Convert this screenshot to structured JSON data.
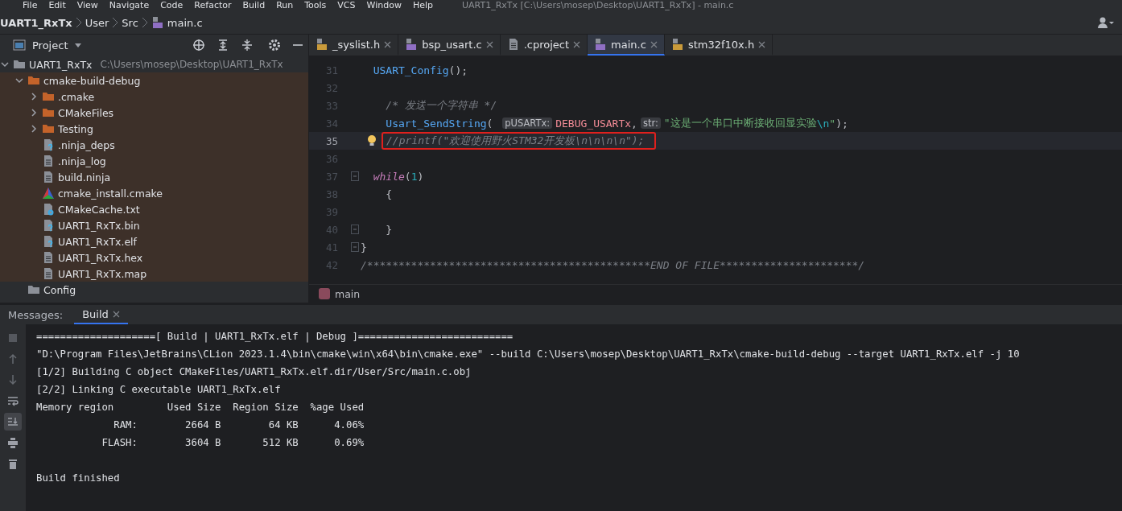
{
  "menu": [
    "File",
    "Edit",
    "View",
    "Navigate",
    "Code",
    "Refactor",
    "Build",
    "Run",
    "Tools",
    "VCS",
    "Window",
    "Help"
  ],
  "window": {
    "title": "UART1_RxTx [C:\\Users\\mosep\\Desktop\\UART1_RxTx] - main.c"
  },
  "breadcrumb": [
    "UART1_RxTx",
    "User",
    "Src",
    "main.c"
  ],
  "project_panel": {
    "title": "Project",
    "tree": [
      {
        "label": "UART1_RxTx",
        "hint": "C:\\Users\\mosep\\Desktop\\UART1_RxTx",
        "kind": "folder-plain",
        "expanded": true,
        "excluded": false,
        "children": [
          {
            "label": "cmake-build-debug",
            "kind": "folder",
            "expanded": true,
            "excluded": true,
            "children": [
              {
                "label": ".cmake",
                "kind": "folder",
                "expanded": false,
                "excluded": true
              },
              {
                "label": "CMakeFiles",
                "kind": "folder",
                "expanded": false,
                "excluded": true
              },
              {
                "label": "Testing",
                "kind": "folder",
                "expanded": false,
                "excluded": true
              },
              {
                "label": ".ninja_deps",
                "kind": "unknown",
                "excluded": true
              },
              {
                "label": ".ninja_log",
                "kind": "text",
                "excluded": true
              },
              {
                "label": "build.ninja",
                "kind": "text",
                "excluded": true
              },
              {
                "label": "cmake_install.cmake",
                "kind": "cmake",
                "excluded": true
              },
              {
                "label": "CMakeCache.txt",
                "kind": "settings",
                "excluded": true
              },
              {
                "label": "UART1_RxTx.bin",
                "kind": "unknown",
                "excluded": true
              },
              {
                "label": "UART1_RxTx.elf",
                "kind": "unknown",
                "excluded": true
              },
              {
                "label": "UART1_RxTx.hex",
                "kind": "text",
                "excluded": true
              },
              {
                "label": "UART1_RxTx.map",
                "kind": "text",
                "excluded": true
              }
            ]
          },
          {
            "label": "Config",
            "kind": "folder-plain",
            "excluded": false
          }
        ]
      }
    ]
  },
  "tabs": [
    {
      "label": "_syslist.h",
      "kind": "h",
      "selected": false
    },
    {
      "label": "bsp_usart.c",
      "kind": "c",
      "selected": false
    },
    {
      "label": ".cproject",
      "kind": "text",
      "selected": false
    },
    {
      "label": "main.c",
      "kind": "c",
      "selected": true
    },
    {
      "label": "stm32f10x.h",
      "kind": "h",
      "selected": false
    }
  ],
  "code": [
    {
      "number": "31",
      "current": false,
      "tokens": [
        {
          "text": "  USART_Config",
          "kind": "fn"
        },
        {
          "text": "();",
          "kind": "punct"
        }
      ]
    },
    {
      "number": "32",
      "current": false
    },
    {
      "number": "33",
      "current": false,
      "tokens": [
        {
          "text": "    /* 发送一个字符串 */",
          "kind": "comment"
        }
      ]
    },
    {
      "number": "34",
      "current": false,
      "tokens": [
        {
          "text": "    Usart_SendString",
          "kind": "fn"
        },
        {
          "text": "( ",
          "kind": "punct"
        },
        {
          "text": "pUSARTx:",
          "kind": "hint"
        },
        {
          "text": "DEBUG_USARTx",
          "kind": "macro"
        },
        {
          "text": ",",
          "kind": "punct"
        },
        {
          "text": "str:",
          "kind": "hint"
        },
        {
          "text": "\"这是一个串口中断接收回显实验",
          "kind": "string"
        },
        {
          "text": "\\n",
          "kind": "escape"
        },
        {
          "text": "\"",
          "kind": "string"
        },
        {
          "text": ");",
          "kind": "punct"
        }
      ]
    },
    {
      "number": "35",
      "current": true,
      "boxed": true,
      "bulb": true,
      "tokens": [
        {
          "text": "//printf(\"欢迎使用野火STM32开发板\\n\\n\\n\\n\");",
          "kind": "comment"
        }
      ]
    },
    {
      "number": "36",
      "current": false
    },
    {
      "number": "37",
      "current": false,
      "fold": true,
      "tokens": [
        {
          "text": "  while",
          "kind": "keyword"
        },
        {
          "text": "(",
          "kind": "punct"
        },
        {
          "text": "1",
          "kind": "number"
        },
        {
          "text": ")",
          "kind": "punct"
        }
      ]
    },
    {
      "number": "38",
      "current": false,
      "tokens": [
        {
          "text": "    {",
          "kind": "punct"
        }
      ]
    },
    {
      "number": "39",
      "current": false
    },
    {
      "number": "40",
      "current": false,
      "fold": true,
      "tokens": [
        {
          "text": "    }",
          "kind": "punct"
        }
      ]
    },
    {
      "number": "41",
      "current": false,
      "fold": true,
      "tokens": [
        {
          "text": "}",
          "kind": "punct"
        }
      ]
    },
    {
      "number": "42",
      "current": false,
      "tokens": [
        {
          "text": "/*********************************************END OF FILE**********************/",
          "kind": "comment"
        }
      ]
    }
  ],
  "editor_breadcrumb": "main",
  "bottom_panel": {
    "label": "Messages:",
    "tabs": [
      {
        "label": "Build",
        "selected": true
      }
    ],
    "tools": [
      {
        "kind": "stop",
        "selected": false
      },
      {
        "kind": "up",
        "selected": false
      },
      {
        "kind": "down",
        "selected": false
      },
      {
        "kind": "wrap",
        "selected": false
      },
      {
        "kind": "scroll-end",
        "selected": true
      },
      {
        "kind": "print",
        "selected": false
      },
      {
        "kind": "trash",
        "selected": false
      }
    ],
    "output": [
      {
        "text": "====================[ Build | UART1_RxTx.elf | Debug ]==========================",
        "kind": "line"
      },
      {
        "text": "\"D:\\Program Files\\JetBrains\\CLion 2023.1.4\\bin\\cmake\\win\\x64\\bin\\cmake.exe\" --build C:\\Users\\mosep\\Desktop\\UART1_RxTx\\cmake-build-debug --target UART1_RxTx.elf -j 10",
        "kind": "line"
      },
      {
        "text": "[1/2] Building C object CMakeFiles/UART1_RxTx.elf.dir/User/Src/main.c.obj",
        "kind": "line"
      },
      {
        "text": "[2/2] Linking C executable UART1_RxTx.elf",
        "kind": "line"
      },
      {
        "text": "Memory region         Used Size  Region Size  %age Used",
        "kind": "line"
      },
      {
        "text": "             RAM:        2664 B        64 KB      4.06%",
        "kind": "line"
      },
      {
        "text": "           FLASH:        3604 B       512 KB      0.69%",
        "kind": "line"
      },
      {
        "text": "Build finished",
        "kind": "status"
      }
    ]
  }
}
